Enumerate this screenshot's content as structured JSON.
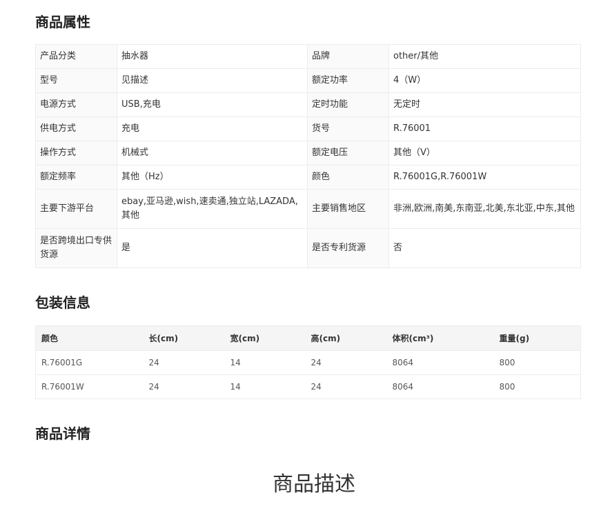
{
  "attributes": {
    "title": "商品属性",
    "rows": [
      [
        "产品分类",
        "抽水器",
        "品牌",
        "other/其他"
      ],
      [
        "型号",
        "见描述",
        "额定功率",
        "4（W）"
      ],
      [
        "电源方式",
        "USB,充电",
        "定时功能",
        "无定时"
      ],
      [
        "供电方式",
        "充电",
        "货号",
        "R.76001"
      ],
      [
        "操作方式",
        "机械式",
        "额定电压",
        "其他（V）"
      ],
      [
        "额定频率",
        "其他（Hz）",
        "颜色",
        "R.76001G,R.76001W"
      ],
      [
        "主要下游平台",
        "ebay,亚马逊,wish,速卖通,独立站,LAZADA,其他",
        "主要销售地区",
        "非洲,欧洲,南美,东南亚,北美,东北亚,中东,其他"
      ],
      [
        "是否跨境出口专供货源",
        "是",
        "是否专利货源",
        "否"
      ]
    ]
  },
  "packaging": {
    "title": "包装信息",
    "headers": [
      "颜色",
      "长(cm)",
      "宽(cm)",
      "高(cm)",
      "体积(cm³)",
      "重量(g)"
    ],
    "rows": [
      [
        "R.76001G",
        "24",
        "14",
        "24",
        "8064",
        "800"
      ],
      [
        "R.76001W",
        "24",
        "14",
        "24",
        "8064",
        "800"
      ]
    ]
  },
  "details": {
    "title": "商品详情",
    "description_heading": "商品描述"
  }
}
